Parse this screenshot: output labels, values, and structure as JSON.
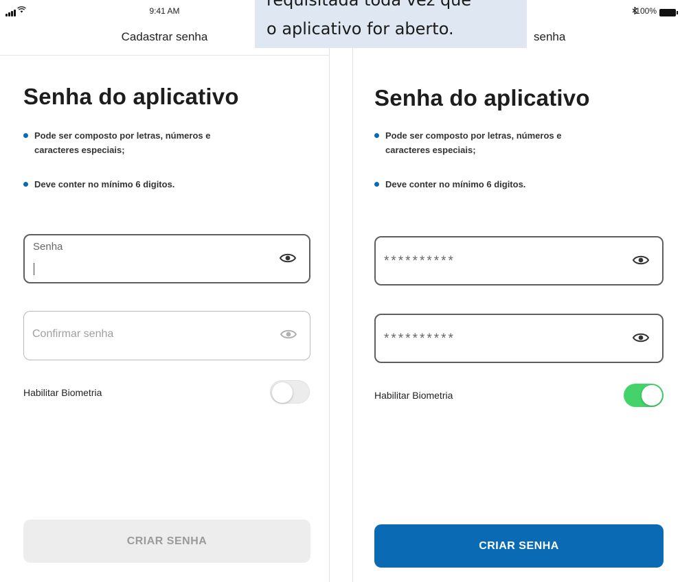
{
  "status_bar": {
    "time": "9:41 AM",
    "wifi_icon": "wifi-icon",
    "bluetooth_icon": "bluetooth-icon",
    "battery_percent": "100%"
  },
  "left_screen": {
    "nav_title": "Cadastrar senha",
    "page_title": "Senha do aplicativo",
    "rules": [
      "Pode ser composto por letras, números e caracteres especiais;",
      "Deve conter no mínimo 6 digitos."
    ],
    "password_field": {
      "label": "Senha",
      "value": ""
    },
    "confirm_field": {
      "placeholder": "Confirmar senha",
      "value": ""
    },
    "biometry": {
      "label": "Habilitar Biometria",
      "enabled": false
    },
    "cta": {
      "label": "CRIAR SENHA",
      "state": "disabled"
    }
  },
  "right_screen": {
    "nav_title_visible": "senha",
    "page_title": "Senha do aplicativo",
    "rules": [
      "Pode ser composto por letras, números e caracteres especiais;",
      "Deve conter no mínimo 6 digitos."
    ],
    "password_field": {
      "value": "**********"
    },
    "confirm_field": {
      "value": "**********"
    },
    "biometry": {
      "label": "Habilitar Biometria",
      "enabled": true
    },
    "cta": {
      "label": "CRIAR SENHA",
      "state": "enabled"
    }
  },
  "tooltip": {
    "line1": "requisitada toda vez que",
    "line2": "o aplicativo for aberto."
  },
  "colors": {
    "accent_blue": "#0a6ab3",
    "toggle_on": "#44d36a",
    "tooltip_bg": "#dfe8f2",
    "disabled_bg": "#ededed"
  }
}
